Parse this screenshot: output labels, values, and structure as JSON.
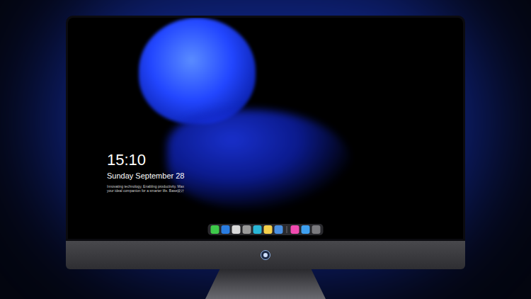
{
  "lock_screen": {
    "time": "15:10",
    "date": "Sunday September 28",
    "slogan_lines": [
      "Innovating technology, Enabling productivity. Max",
      "your ideal companion for a smarter life. Base设计"
    ]
  },
  "dock": {
    "items": [
      {
        "kind": "app",
        "color": "#3ec94a"
      },
      {
        "kind": "app",
        "color": "#2a7de1"
      },
      {
        "kind": "app",
        "color": "#d9d9d9"
      },
      {
        "kind": "app",
        "color": "#9a9a9a"
      },
      {
        "kind": "app",
        "color": "#29b6d6"
      },
      {
        "kind": "app",
        "color": "#f5d04b"
      },
      {
        "kind": "app",
        "color": "#4a90e2"
      },
      {
        "kind": "separator",
        "color": "#6b6b70"
      },
      {
        "kind": "app",
        "color": "#f04bb0"
      },
      {
        "kind": "app",
        "color": "#3ea0f0"
      },
      {
        "kind": "app",
        "color": "#7a7a7e"
      }
    ]
  }
}
